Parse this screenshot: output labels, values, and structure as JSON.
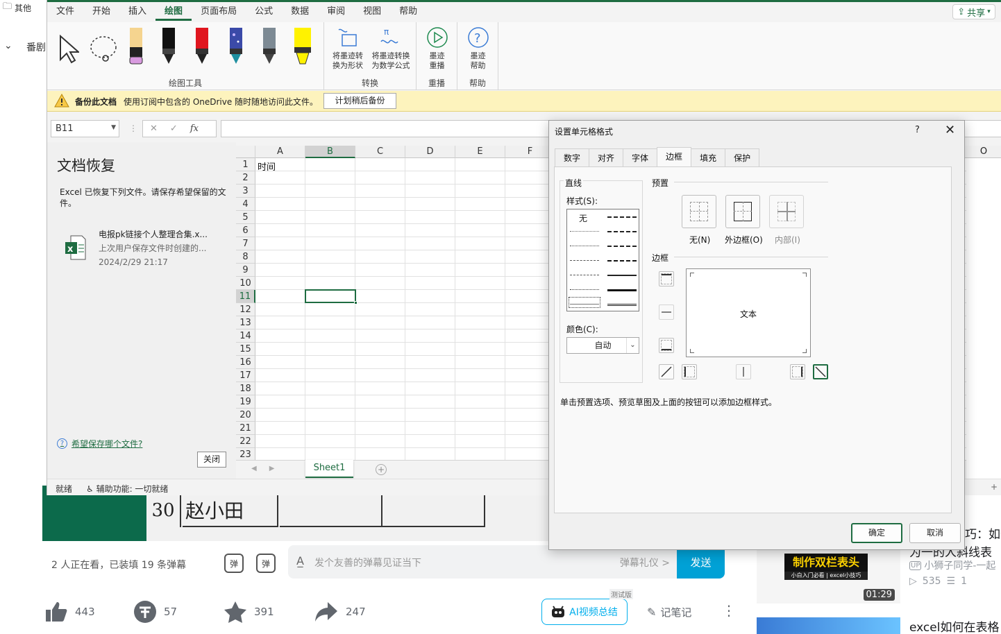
{
  "bg": {
    "nav_folder": "其他",
    "nav_fan": "番剧",
    "video_row_num": "30",
    "video_row_name": "赵小田",
    "danmu_count": "2 人正在看，已装填 19 条弹幕",
    "danmu_icon1": "弹",
    "danmu_icon2": "弹",
    "danmu_placeholder": "发个友善的弹幕见证当下",
    "danmu_etiquette": "弹幕礼仪 >",
    "send": "发送",
    "like": "443",
    "coin": "57",
    "fav": "391",
    "share_count": "247",
    "ai_summary": "AI视频总结",
    "ai_beta": "测试版",
    "note": "记笔记",
    "rec_title_1": "巧：如何",
    "rec_title_1b": "为一的人斜线表",
    "rec_thumb_title": "制作双栏表头",
    "rec_thumb_sub": "小白入门必看 | excel小技巧",
    "rec_duration": "01:29",
    "rec_up": "小狮子同学-一起",
    "rec_views": "535",
    "rec_danmu": "1",
    "rec_title_2": "excel如何在表格"
  },
  "excel": {
    "share_label": "共享",
    "menu": [
      "文件",
      "开始",
      "插入",
      "绘图",
      "页面布局",
      "公式",
      "数据",
      "审阅",
      "视图",
      "帮助"
    ],
    "menu_active": "绘图",
    "ribbon": {
      "group_draw": "绘图工具",
      "group_convert": "转换",
      "group_replay": "重播",
      "group_help": "帮助",
      "ink_to_shape": "将墨迹转\n换为形状",
      "ink_to_math": "将墨迹转换\n为数学公式",
      "ink_replay": "墨迹\n重播",
      "ink_help": "墨迹\n帮助"
    },
    "infobar": {
      "title": "备份此文档",
      "text": "使用订阅中包含的 OneDrive 随时随地访问此文件。",
      "button": "计划稍后备份"
    },
    "namebox": "B11",
    "fx": "fx",
    "recovery": {
      "title": "文档恢复",
      "desc": "Excel 已恢复下列文件。请保存希望保留的文件。",
      "file_name": "电报pk链接个人整理合集.x...",
      "file_sub": "上次用户保存文件时创建的...",
      "file_date": "2024/2/29 21:17",
      "help_link": "希望保存哪个文件?",
      "close": "关闭"
    },
    "columns": [
      "A",
      "B",
      "C",
      "D",
      "E",
      "F"
    ],
    "column_o": "O",
    "rows": [
      "1",
      "2",
      "3",
      "4",
      "5",
      "6",
      "7",
      "8",
      "9",
      "10",
      "11",
      "12",
      "13",
      "14",
      "15",
      "16",
      "17",
      "18",
      "19",
      "20",
      "21",
      "22",
      "23"
    ],
    "cell_a1": "时间",
    "active_cell": "B11",
    "sheet_tab": "Sheet1",
    "status_ready": "就绪",
    "status_access": "辅助功能: 一切就绪"
  },
  "dialog": {
    "title": "设置单元格格式",
    "help": "?",
    "close": "✕",
    "tabs": [
      "数字",
      "对齐",
      "字体",
      "边框",
      "填充",
      "保护"
    ],
    "active_tab": "边框",
    "line_group": "直线",
    "style_label": "样式(S):",
    "style_none": "无",
    "color_label": "颜色(C):",
    "color_value": "自动",
    "preset_group": "预置",
    "preset_none": "无(N)",
    "preset_outline": "外边框(O)",
    "preset_inside": "内部(I)",
    "border_group": "边框",
    "preview_text": "文本",
    "hint": "单击预置选项、预览草图及上面的按钮可以添加边框样式。",
    "ok": "确定",
    "cancel": "取消"
  },
  "colors": {
    "excel_green": "#1e6c41",
    "bili_blue": "#00a1d6",
    "info_yellow": "#fdf3bd"
  }
}
